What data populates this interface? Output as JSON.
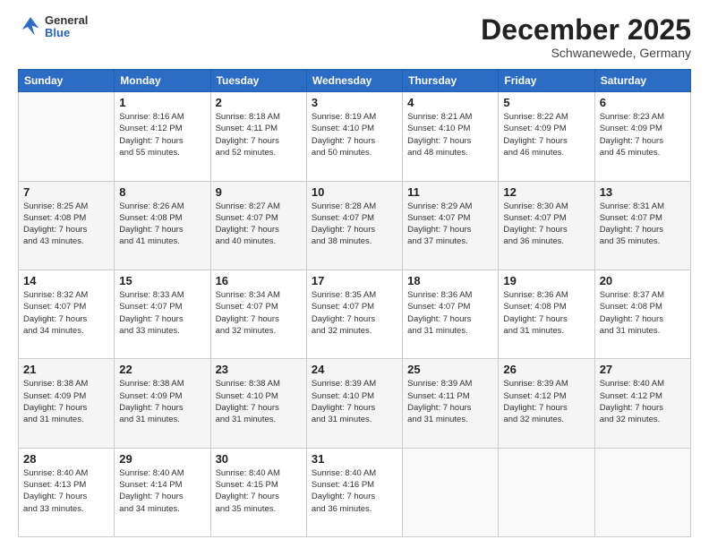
{
  "header": {
    "logo": {
      "general": "General",
      "blue": "Blue"
    },
    "title": "December 2025",
    "subtitle": "Schwanewede, Germany"
  },
  "days_of_week": [
    "Sunday",
    "Monday",
    "Tuesday",
    "Wednesday",
    "Thursday",
    "Friday",
    "Saturday"
  ],
  "weeks": [
    [
      {
        "day": "",
        "sunrise": "",
        "sunset": "",
        "daylight": ""
      },
      {
        "day": "1",
        "sunrise": "Sunrise: 8:16 AM",
        "sunset": "Sunset: 4:12 PM",
        "daylight": "Daylight: 7 hours and 55 minutes."
      },
      {
        "day": "2",
        "sunrise": "Sunrise: 8:18 AM",
        "sunset": "Sunset: 4:11 PM",
        "daylight": "Daylight: 7 hours and 52 minutes."
      },
      {
        "day": "3",
        "sunrise": "Sunrise: 8:19 AM",
        "sunset": "Sunset: 4:10 PM",
        "daylight": "Daylight: 7 hours and 50 minutes."
      },
      {
        "day": "4",
        "sunrise": "Sunrise: 8:21 AM",
        "sunset": "Sunset: 4:10 PM",
        "daylight": "Daylight: 7 hours and 48 minutes."
      },
      {
        "day": "5",
        "sunrise": "Sunrise: 8:22 AM",
        "sunset": "Sunset: 4:09 PM",
        "daylight": "Daylight: 7 hours and 46 minutes."
      },
      {
        "day": "6",
        "sunrise": "Sunrise: 8:23 AM",
        "sunset": "Sunset: 4:09 PM",
        "daylight": "Daylight: 7 hours and 45 minutes."
      }
    ],
    [
      {
        "day": "7",
        "sunrise": "Sunrise: 8:25 AM",
        "sunset": "Sunset: 4:08 PM",
        "daylight": "Daylight: 7 hours and 43 minutes."
      },
      {
        "day": "8",
        "sunrise": "Sunrise: 8:26 AM",
        "sunset": "Sunset: 4:08 PM",
        "daylight": "Daylight: 7 hours and 41 minutes."
      },
      {
        "day": "9",
        "sunrise": "Sunrise: 8:27 AM",
        "sunset": "Sunset: 4:07 PM",
        "daylight": "Daylight: 7 hours and 40 minutes."
      },
      {
        "day": "10",
        "sunrise": "Sunrise: 8:28 AM",
        "sunset": "Sunset: 4:07 PM",
        "daylight": "Daylight: 7 hours and 38 minutes."
      },
      {
        "day": "11",
        "sunrise": "Sunrise: 8:29 AM",
        "sunset": "Sunset: 4:07 PM",
        "daylight": "Daylight: 7 hours and 37 minutes."
      },
      {
        "day": "12",
        "sunrise": "Sunrise: 8:30 AM",
        "sunset": "Sunset: 4:07 PM",
        "daylight": "Daylight: 7 hours and 36 minutes."
      },
      {
        "day": "13",
        "sunrise": "Sunrise: 8:31 AM",
        "sunset": "Sunset: 4:07 PM",
        "daylight": "Daylight: 7 hours and 35 minutes."
      }
    ],
    [
      {
        "day": "14",
        "sunrise": "Sunrise: 8:32 AM",
        "sunset": "Sunset: 4:07 PM",
        "daylight": "Daylight: 7 hours and 34 minutes."
      },
      {
        "day": "15",
        "sunrise": "Sunrise: 8:33 AM",
        "sunset": "Sunset: 4:07 PM",
        "daylight": "Daylight: 7 hours and 33 minutes."
      },
      {
        "day": "16",
        "sunrise": "Sunrise: 8:34 AM",
        "sunset": "Sunset: 4:07 PM",
        "daylight": "Daylight: 7 hours and 32 minutes."
      },
      {
        "day": "17",
        "sunrise": "Sunrise: 8:35 AM",
        "sunset": "Sunset: 4:07 PM",
        "daylight": "Daylight: 7 hours and 32 minutes."
      },
      {
        "day": "18",
        "sunrise": "Sunrise: 8:36 AM",
        "sunset": "Sunset: 4:07 PM",
        "daylight": "Daylight: 7 hours and 31 minutes."
      },
      {
        "day": "19",
        "sunrise": "Sunrise: 8:36 AM",
        "sunset": "Sunset: 4:08 PM",
        "daylight": "Daylight: 7 hours and 31 minutes."
      },
      {
        "day": "20",
        "sunrise": "Sunrise: 8:37 AM",
        "sunset": "Sunset: 4:08 PM",
        "daylight": "Daylight: 7 hours and 31 minutes."
      }
    ],
    [
      {
        "day": "21",
        "sunrise": "Sunrise: 8:38 AM",
        "sunset": "Sunset: 4:09 PM",
        "daylight": "Daylight: 7 hours and 31 minutes."
      },
      {
        "day": "22",
        "sunrise": "Sunrise: 8:38 AM",
        "sunset": "Sunset: 4:09 PM",
        "daylight": "Daylight: 7 hours and 31 minutes."
      },
      {
        "day": "23",
        "sunrise": "Sunrise: 8:38 AM",
        "sunset": "Sunset: 4:10 PM",
        "daylight": "Daylight: 7 hours and 31 minutes."
      },
      {
        "day": "24",
        "sunrise": "Sunrise: 8:39 AM",
        "sunset": "Sunset: 4:10 PM",
        "daylight": "Daylight: 7 hours and 31 minutes."
      },
      {
        "day": "25",
        "sunrise": "Sunrise: 8:39 AM",
        "sunset": "Sunset: 4:11 PM",
        "daylight": "Daylight: 7 hours and 31 minutes."
      },
      {
        "day": "26",
        "sunrise": "Sunrise: 8:39 AM",
        "sunset": "Sunset: 4:12 PM",
        "daylight": "Daylight: 7 hours and 32 minutes."
      },
      {
        "day": "27",
        "sunrise": "Sunrise: 8:40 AM",
        "sunset": "Sunset: 4:12 PM",
        "daylight": "Daylight: 7 hours and 32 minutes."
      }
    ],
    [
      {
        "day": "28",
        "sunrise": "Sunrise: 8:40 AM",
        "sunset": "Sunset: 4:13 PM",
        "daylight": "Daylight: 7 hours and 33 minutes."
      },
      {
        "day": "29",
        "sunrise": "Sunrise: 8:40 AM",
        "sunset": "Sunset: 4:14 PM",
        "daylight": "Daylight: 7 hours and 34 minutes."
      },
      {
        "day": "30",
        "sunrise": "Sunrise: 8:40 AM",
        "sunset": "Sunset: 4:15 PM",
        "daylight": "Daylight: 7 hours and 35 minutes."
      },
      {
        "day": "31",
        "sunrise": "Sunrise: 8:40 AM",
        "sunset": "Sunset: 4:16 PM",
        "daylight": "Daylight: 7 hours and 36 minutes."
      },
      {
        "day": "",
        "sunrise": "",
        "sunset": "",
        "daylight": ""
      },
      {
        "day": "",
        "sunrise": "",
        "sunset": "",
        "daylight": ""
      },
      {
        "day": "",
        "sunrise": "",
        "sunset": "",
        "daylight": ""
      }
    ]
  ]
}
